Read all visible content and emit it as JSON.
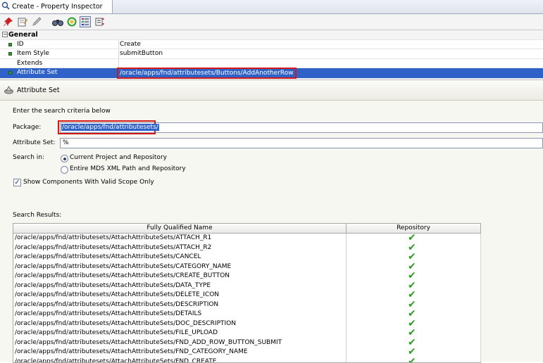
{
  "window": {
    "tab_title": "Create - Property Inspector"
  },
  "toolbar": {
    "buttons": [
      "pin-icon",
      "edit-properties-icon",
      "pencil-icon",
      "find-icon",
      "refresh-icon",
      "categorize-icon",
      "sort-icon"
    ]
  },
  "inspector": {
    "group_label": "General",
    "rows": [
      {
        "name": "ID",
        "value": "Create"
      },
      {
        "name": "Item Style",
        "value": "submitButton"
      },
      {
        "name": "Extends",
        "value": ""
      },
      {
        "name": "Attribute Set",
        "value": "/oracle/apps/fnd/attributesets/Buttons/AddAnotherRow"
      }
    ]
  },
  "dialog": {
    "title": "Attribute Set",
    "instruction": "Enter the search criteria below",
    "package_label": "Package:",
    "package_value": "/oracle/apps/fnd/attributesets/",
    "attribute_set_label": "Attribute Set:",
    "attribute_set_value": "%",
    "search_in_label": "Search in:",
    "radio_current": "Current Project and Repository",
    "radio_entire": "Entire MDS XML Path and Repository",
    "checkbox_label": "Show Components With Valid Scope Only",
    "results_label": "Search Results:",
    "columns": [
      "Fully Qualified Name",
      "Repository"
    ],
    "results": [
      "/oracle/apps/fnd/attributesets/AttachAttributeSets/ATTACH_R1",
      "/oracle/apps/fnd/attributesets/AttachAttributeSets/ATTACH_R2",
      "/oracle/apps/fnd/attributesets/AttachAttributeSets/CANCEL",
      "/oracle/apps/fnd/attributesets/AttachAttributeSets/CATEGORY_NAME",
      "/oracle/apps/fnd/attributesets/AttachAttributeSets/CREATE_BUTTON",
      "/oracle/apps/fnd/attributesets/AttachAttributeSets/DATA_TYPE",
      "/oracle/apps/fnd/attributesets/AttachAttributeSets/DELETE_ICON",
      "/oracle/apps/fnd/attributesets/AttachAttributeSets/DESCRIPTION",
      "/oracle/apps/fnd/attributesets/AttachAttributeSets/DETAILS",
      "/oracle/apps/fnd/attributesets/AttachAttributeSets/DOC_DESCRIPTION",
      "/oracle/apps/fnd/attributesets/AttachAttributeSets/FILE_UPLOAD",
      "/oracle/apps/fnd/attributesets/AttachAttributeSets/FND_ADD_ROW_BUTTON_SUBMIT",
      "/oracle/apps/fnd/attributesets/AttachAttributeSets/FND_CATEGORY_NAME",
      "/oracle/apps/fnd/attributesets/AttachAttributeSets/FND_CREATE"
    ],
    "repository_mark": "✔",
    "colors": {
      "selection": "#2f62c8",
      "highlight_box": "#d31818",
      "check": "#2d9a22"
    }
  }
}
